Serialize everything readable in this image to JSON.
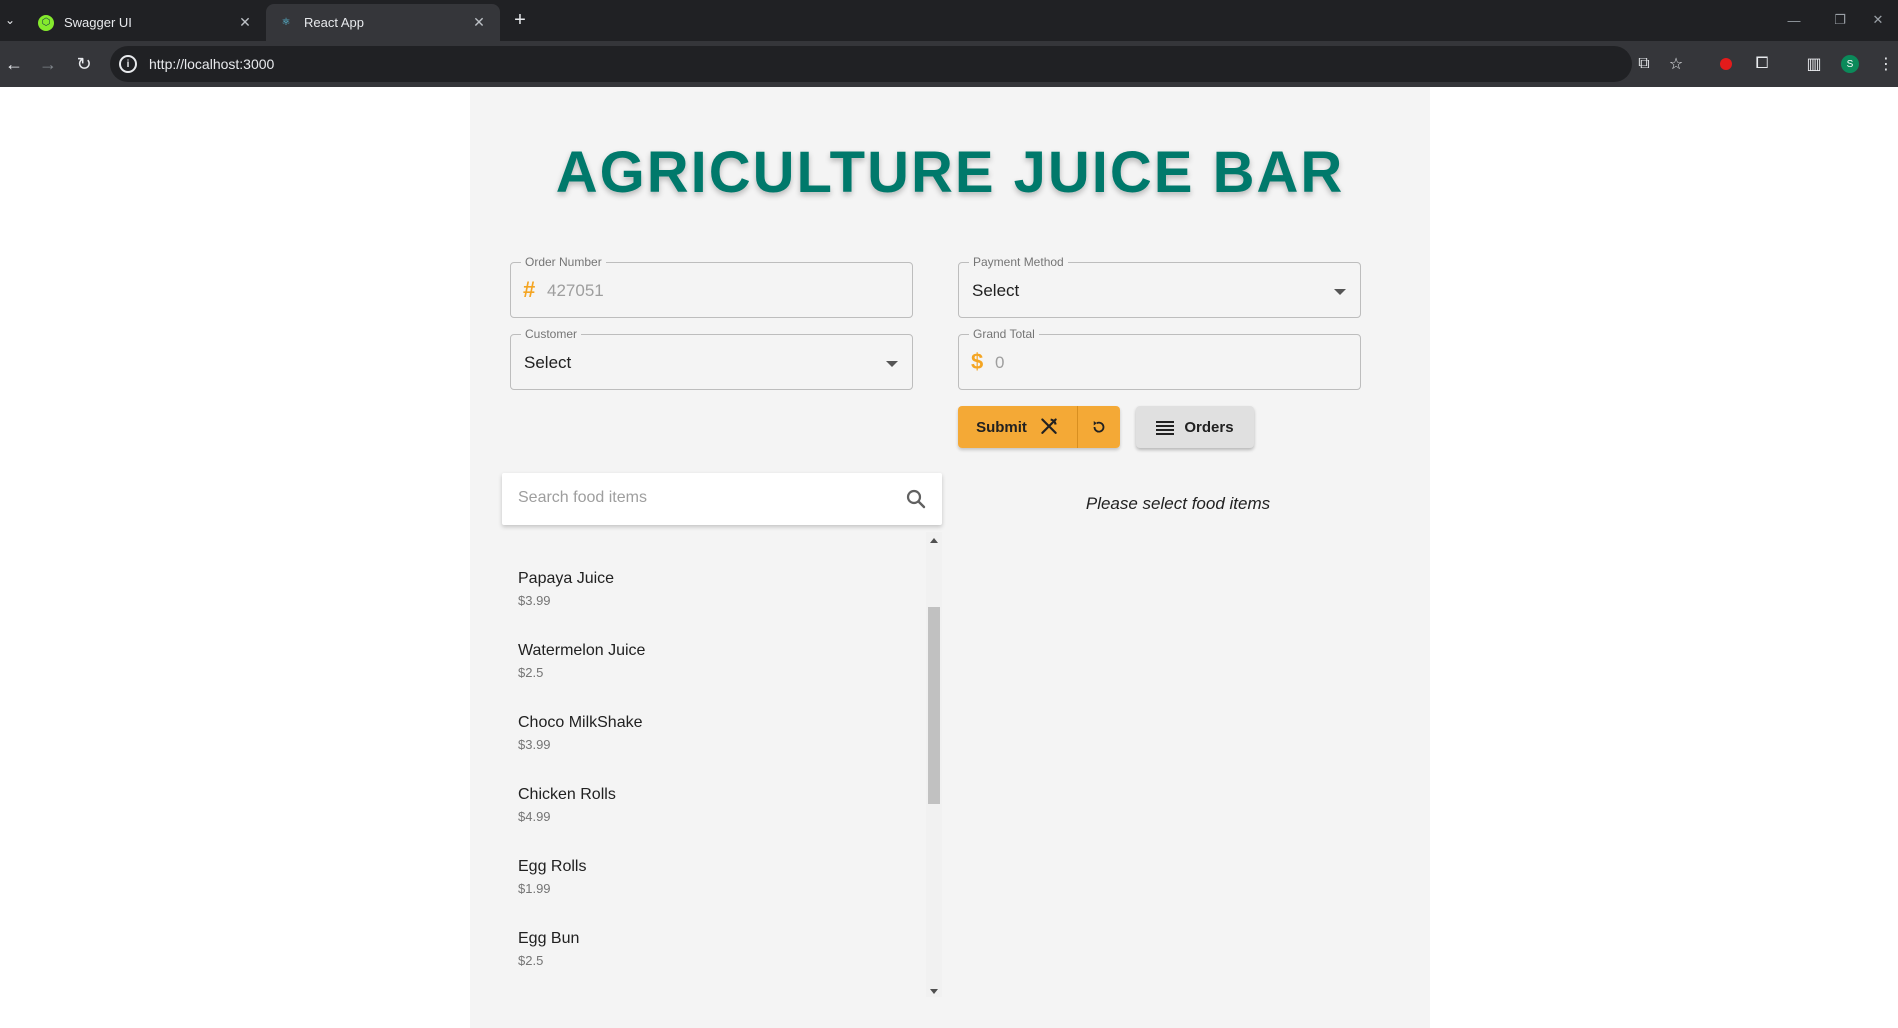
{
  "browser": {
    "tabs": [
      {
        "title": "Swagger UI",
        "active": false
      },
      {
        "title": "React App",
        "active": true
      }
    ],
    "url": "http://localhost:3000",
    "profile_initial": "S"
  },
  "app": {
    "title": "AGRICULTURE JUICE BAR",
    "order_number": {
      "label": "Order Number",
      "prefix": "#",
      "value": "427051"
    },
    "payment_method": {
      "label": "Payment Method",
      "value": "Select"
    },
    "customer": {
      "label": "Customer",
      "value": "Select"
    },
    "grand_total": {
      "label": "Grand Total",
      "prefix": "$",
      "value": "0"
    },
    "submit_label": "Submit",
    "orders_label": "Orders",
    "search_placeholder": "Search food items",
    "empty_message": "Please select food items",
    "food_items": [
      {
        "name": "Papaya Juice",
        "price": "$3.99"
      },
      {
        "name": "Watermelon Juice",
        "price": "$2.5"
      },
      {
        "name": "Choco MilkShake",
        "price": "$3.99"
      },
      {
        "name": "Chicken Rolls",
        "price": "$4.99"
      },
      {
        "name": "Egg Rolls",
        "price": "$1.99"
      },
      {
        "name": "Egg Bun",
        "price": "$2.5"
      }
    ]
  },
  "colors": {
    "heading": "#00796b",
    "accent": "#f4a936",
    "paper_bg": "#f4f4f4"
  }
}
